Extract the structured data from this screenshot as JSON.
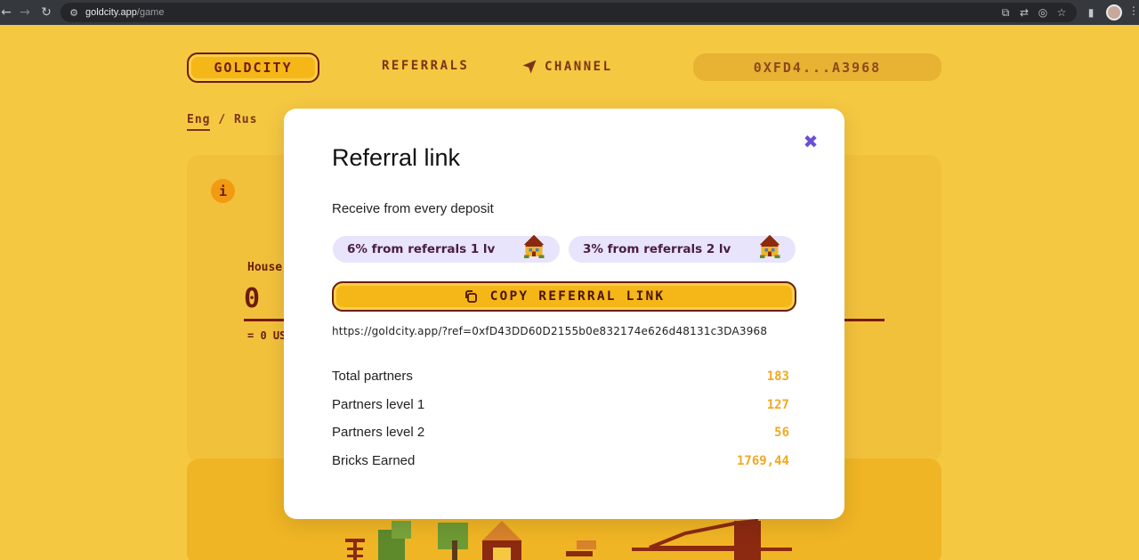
{
  "browser": {
    "url_host": "goldcity.app",
    "url_path": "/game"
  },
  "header": {
    "logo": "GOLDCITY",
    "nav_referrals": "REFERRALS",
    "nav_channel": "CHANNEL",
    "wallet": "0XFD4...A3968"
  },
  "lang": {
    "eng": "Eng",
    "sep": "/",
    "rus": "Rus"
  },
  "background": {
    "info": "i",
    "houses_label": "House",
    "houses_value": "0",
    "houses_usd": "= 0 US"
  },
  "modal": {
    "title": "Referral link",
    "subtitle": "Receive from every deposit",
    "pills": [
      {
        "label": "6% from referrals 1 lv"
      },
      {
        "label": "3% from referrals 2 lv"
      }
    ],
    "copy_button": "COPY REFERRAL LINK",
    "ref_url": "https://goldcity.app/?ref=0xfD43DD60D2155b0e832174e626d48131c3DA3968",
    "stats": [
      {
        "label": "Total partners",
        "value": "183"
      },
      {
        "label": "Partners level 1",
        "value": "127"
      },
      {
        "label": "Partners level 2",
        "value": "56"
      },
      {
        "label": "Bricks Earned",
        "value": "1769,44"
      }
    ]
  },
  "colors": {
    "page_bg": "#f5c842",
    "accent_purple": "#6b4fd8",
    "stat_value": "#f2a922",
    "dark_brown": "#6b1d0c"
  }
}
